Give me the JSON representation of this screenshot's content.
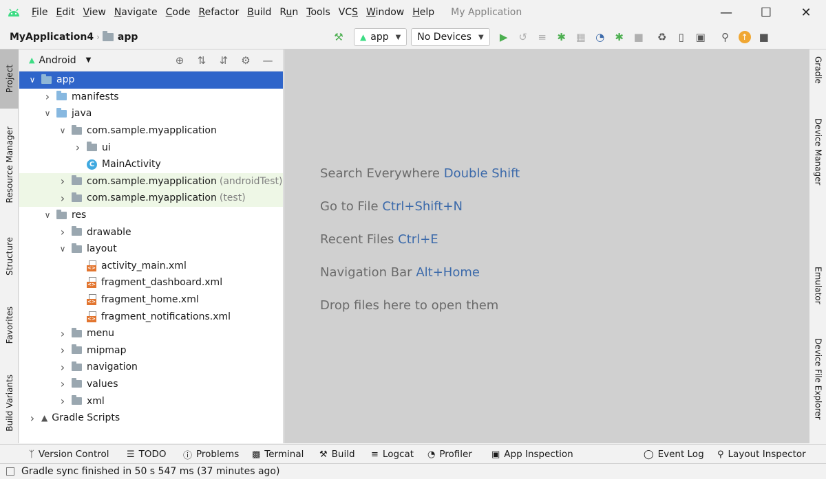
{
  "menubar": {
    "items": [
      {
        "label": "File",
        "ul": "F"
      },
      {
        "label": "Edit",
        "ul": "E"
      },
      {
        "label": "View",
        "ul": "V"
      },
      {
        "label": "Navigate",
        "ul": "N"
      },
      {
        "label": "Code",
        "ul": "C"
      },
      {
        "label": "Refactor",
        "ul": "R"
      },
      {
        "label": "Build",
        "ul": "B"
      },
      {
        "label": "Run",
        "ul": "u"
      },
      {
        "label": "Tools",
        "ul": "T"
      },
      {
        "label": "VCS",
        "ul": "S"
      },
      {
        "label": "Window",
        "ul": "W"
      },
      {
        "label": "Help",
        "ul": "H"
      }
    ],
    "app_title": "My Application"
  },
  "navbar": {
    "project": "MyApplication4",
    "module": "app",
    "run_config": "app",
    "device": "No Devices"
  },
  "left_strip": {
    "tabs": [
      "Project",
      "Resource Manager",
      "Structure",
      "Favorites",
      "Build Variants"
    ]
  },
  "right_strip": {
    "tabs": [
      "Gradle",
      "Device Manager",
      "Emulator",
      "Device File Explorer"
    ]
  },
  "project_panel": {
    "view": "Android",
    "tree": [
      {
        "label": "app",
        "depth": 0,
        "chev": "down",
        "icon": "module",
        "selected": true
      },
      {
        "label": "manifests",
        "depth": 1,
        "chev": "right",
        "icon": "blue"
      },
      {
        "label": "java",
        "depth": 1,
        "chev": "down",
        "icon": "blue"
      },
      {
        "label": "com.sample.myapplication",
        "depth": 2,
        "chev": "down",
        "icon": "gray"
      },
      {
        "label": "ui",
        "depth": 3,
        "chev": "right",
        "icon": "gray"
      },
      {
        "label": "MainActivity",
        "depth": 3,
        "chev": "none",
        "icon": "class"
      },
      {
        "label": "com.sample.myapplication",
        "suffix": "(androidTest)",
        "depth": 2,
        "chev": "right",
        "icon": "gray",
        "test": true
      },
      {
        "label": "com.sample.myapplication",
        "suffix": "(test)",
        "depth": 2,
        "chev": "right",
        "icon": "gray",
        "test": true
      },
      {
        "label": "res",
        "depth": 1,
        "chev": "down",
        "icon": "res"
      },
      {
        "label": "drawable",
        "depth": 2,
        "chev": "right",
        "icon": "gray"
      },
      {
        "label": "layout",
        "depth": 2,
        "chev": "down",
        "icon": "gray"
      },
      {
        "label": "activity_main.xml",
        "depth": 3,
        "chev": "none",
        "icon": "xml"
      },
      {
        "label": "fragment_dashboard.xml",
        "depth": 3,
        "chev": "none",
        "icon": "xml"
      },
      {
        "label": "fragment_home.xml",
        "depth": 3,
        "chev": "none",
        "icon": "xml"
      },
      {
        "label": "fragment_notifications.xml",
        "depth": 3,
        "chev": "none",
        "icon": "xml"
      },
      {
        "label": "menu",
        "depth": 2,
        "chev": "right",
        "icon": "gray"
      },
      {
        "label": "mipmap",
        "depth": 2,
        "chev": "right",
        "icon": "gray"
      },
      {
        "label": "navigation",
        "depth": 2,
        "chev": "right",
        "icon": "gray"
      },
      {
        "label": "values",
        "depth": 2,
        "chev": "right",
        "icon": "gray"
      },
      {
        "label": "xml",
        "depth": 2,
        "chev": "right",
        "icon": "gray"
      },
      {
        "label": "Gradle Scripts",
        "depth": 0,
        "chev": "right",
        "icon": "gradle"
      }
    ]
  },
  "editor": {
    "hints": [
      {
        "text": "Search Everywhere",
        "key": "Double Shift"
      },
      {
        "text": "Go to File",
        "key": "Ctrl+Shift+N"
      },
      {
        "text": "Recent Files",
        "key": "Ctrl+E"
      },
      {
        "text": "Navigation Bar",
        "key": "Alt+Home"
      },
      {
        "text": "Drop files here to open them",
        "key": ""
      }
    ]
  },
  "bottombar": {
    "version_control": "Version Control",
    "todo": "TODO",
    "problems": "Problems",
    "terminal": "Terminal",
    "build": "Build",
    "logcat": "Logcat",
    "profiler": "Profiler",
    "app_inspection": "App Inspection",
    "event_log": "Event Log",
    "layout_inspector": "Layout Inspector"
  },
  "status": {
    "message": "Gradle sync finished in 50 s 547 ms (37 minutes ago)"
  },
  "colors": {
    "selection": "#2f65ca",
    "android_green": "#3ddc84",
    "run_green": "#4caf50",
    "hint_key": "#3c6aaa",
    "editor_bg": "#d0d0d0"
  }
}
